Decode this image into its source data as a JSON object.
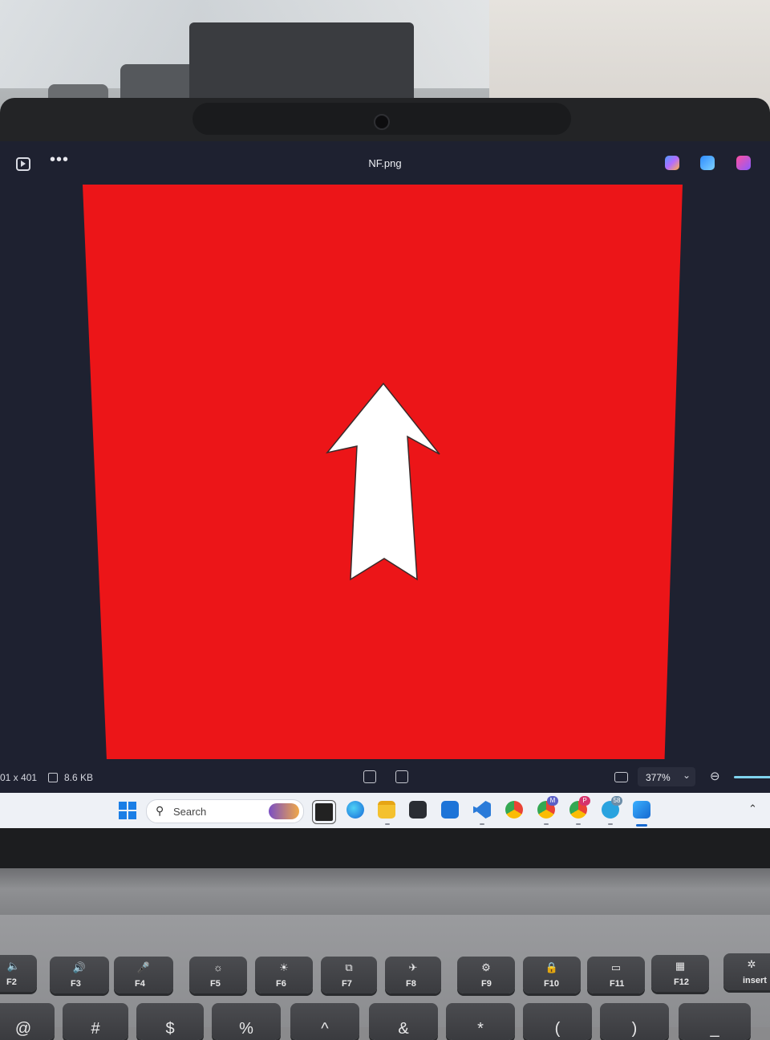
{
  "window": {
    "file_title": "NF.png"
  },
  "statusbar": {
    "dimensions": "01 x 401",
    "file_size": "8.6 KB",
    "zoom_value": "377%"
  },
  "taskbar": {
    "search_label": "Search",
    "badges": {
      "chrome_m": "M",
      "chrome_p": "P",
      "telegram": "58"
    }
  },
  "keyboard": {
    "fkeys": [
      "F2",
      "F3",
      "F4",
      "F5",
      "F6",
      "F7",
      "F8",
      "F9",
      "F10",
      "F11",
      "F12",
      "insert"
    ],
    "number_row": [
      "@",
      "#",
      "$",
      "%",
      "^",
      "&",
      "*",
      "(",
      ")",
      "_"
    ]
  },
  "colors": {
    "image_background": "#ec1518",
    "arrow_fill": "#ffffff",
    "screen_background": "#1e2130",
    "taskbar_background": "#eef1f6"
  }
}
